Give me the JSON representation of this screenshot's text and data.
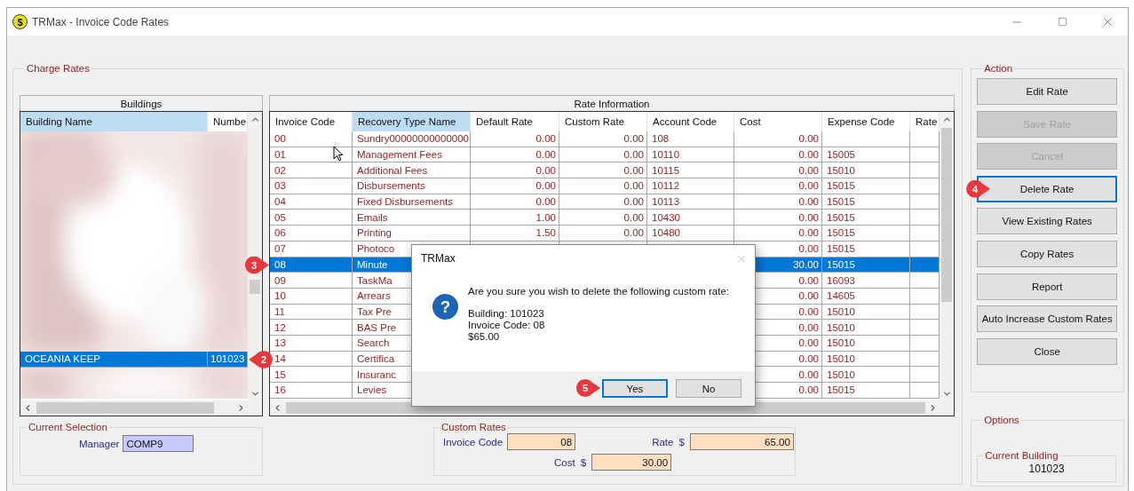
{
  "window": {
    "title": "TRMax - Invoice Code Rates",
    "icon_symbol": "$"
  },
  "charge_rates": {
    "title": "Charge Rates",
    "buildings": {
      "title": "Buildings",
      "columns": [
        {
          "label": "Building Name",
          "selected": true
        },
        {
          "label": "Numbe",
          "selected": false
        }
      ],
      "rows": [
        {
          "name": "OCEANIA KEEP",
          "number": "101023",
          "selected": true,
          "marker": "2"
        }
      ]
    },
    "rate_information": {
      "title": "Rate Information",
      "columns": [
        {
          "label": "Invoice Code",
          "selected": false
        },
        {
          "label": "Recovery Type Name",
          "selected": true
        },
        {
          "label": "Default Rate",
          "selected": false
        },
        {
          "label": "Custom Rate",
          "selected": false
        },
        {
          "label": "Account Code",
          "selected": false
        },
        {
          "label": "Cost",
          "selected": false
        },
        {
          "label": "Expense Code",
          "selected": false
        },
        {
          "label": "Rate",
          "selected": false
        }
      ],
      "rows": [
        {
          "cells": [
            "00",
            "Sundry00000000000000",
            "0.00",
            "0.00",
            "108",
            "0.00",
            null
          ],
          "selected": false
        },
        {
          "cells": [
            "01",
            "Management Fees",
            "0.00",
            "0.00",
            "10110",
            "0.00",
            "15005"
          ],
          "selected": false
        },
        {
          "cells": [
            "02",
            "Additional Fees",
            "0.00",
            "0.00",
            "10115",
            "0.00",
            "15010"
          ],
          "selected": false
        },
        {
          "cells": [
            "03",
            "Disbursements",
            "0.00",
            "0.00",
            "10112",
            "0.00",
            "15015"
          ],
          "selected": false
        },
        {
          "cells": [
            "04",
            "Fixed Disbursements",
            "0.00",
            "0.00",
            "10113",
            "0.00",
            "15015"
          ],
          "selected": false
        },
        {
          "cells": [
            "05",
            "Emails",
            "1.00",
            "0.00",
            "10430",
            "0.00",
            "15015"
          ],
          "selected": false
        },
        {
          "cells": [
            "06",
            "Printing",
            "1.50",
            "0.00",
            "10480",
            "0.00",
            "15015"
          ],
          "selected": false
        },
        {
          "cells": [
            "07",
            "Photoco",
            null,
            null,
            null,
            "0.00",
            "15015"
          ],
          "selected": false
        },
        {
          "cells": [
            "08",
            "Minute",
            null,
            null,
            null,
            "30.00",
            "15015"
          ],
          "selected": true,
          "marker": "3"
        },
        {
          "cells": [
            "09",
            "TaskMa",
            null,
            null,
            null,
            "0.00",
            "16093"
          ],
          "selected": false
        },
        {
          "cells": [
            "10",
            "Arrears",
            null,
            null,
            null,
            "0.00",
            "14605"
          ],
          "selected": false
        },
        {
          "cells": [
            "11",
            "Tax Pre",
            null,
            null,
            null,
            "0.00",
            "15010"
          ],
          "selected": false
        },
        {
          "cells": [
            "12",
            "BAS Pre",
            null,
            null,
            null,
            "0.00",
            "15010"
          ],
          "selected": false
        },
        {
          "cells": [
            "13",
            "Search",
            null,
            null,
            null,
            "0.00",
            "15010"
          ],
          "selected": false
        },
        {
          "cells": [
            "14",
            "Certifica",
            null,
            null,
            null,
            "0.00",
            "15010"
          ],
          "selected": false
        },
        {
          "cells": [
            "15",
            "Insuranc",
            null,
            null,
            null,
            "0.00",
            "15010"
          ],
          "selected": false
        },
        {
          "cells": [
            "16",
            "Levies",
            null,
            null,
            null,
            "0.00",
            "15015"
          ],
          "selected": false
        }
      ]
    },
    "current_selection": {
      "title": "Current Selection",
      "manager_label": "Manager",
      "manager": "COMP9"
    },
    "custom_rates": {
      "title": "Custom Rates",
      "invoice_code": {
        "label": "Invoice Code",
        "value": "08"
      },
      "rate": {
        "label": "Rate",
        "unit": "$",
        "value": "65.00"
      },
      "cost": {
        "label": "Cost",
        "unit": "$",
        "value": "30.00"
      }
    }
  },
  "dialog": {
    "title": "TRMax",
    "icon_symbol": "?",
    "message": "Are you sure you wish to delete the following custom rate:",
    "details": [
      "Building: 101023",
      "Invoice Code: 08",
      "$65.00"
    ],
    "buttons": [
      {
        "label": "Yes",
        "focused": true,
        "marker": "5"
      },
      {
        "label": "No",
        "focused": false
      }
    ]
  },
  "action": {
    "title": "Action",
    "buttons": [
      {
        "label": "Edit Rate",
        "disabled": false,
        "focused": false
      },
      {
        "label": "Save Rate",
        "disabled": true,
        "focused": false
      },
      {
        "label": "Cancel",
        "disabled": true,
        "focused": false
      },
      {
        "label": "Delete Rate",
        "disabled": false,
        "focused": true,
        "marker": "4"
      },
      {
        "label": "View Existing Rates",
        "disabled": false,
        "focused": false
      },
      {
        "label": "Copy Rates",
        "disabled": false,
        "focused": false
      },
      {
        "label": "Report",
        "disabled": false,
        "focused": false
      },
      {
        "label": "Auto Increase Custom Rates",
        "disabled": false,
        "focused": false
      },
      {
        "label": "Close",
        "disabled": false,
        "focused": false
      }
    ]
  },
  "options": {
    "title": "Options",
    "current_building": {
      "title": "Current Building",
      "value": "101023"
    }
  }
}
